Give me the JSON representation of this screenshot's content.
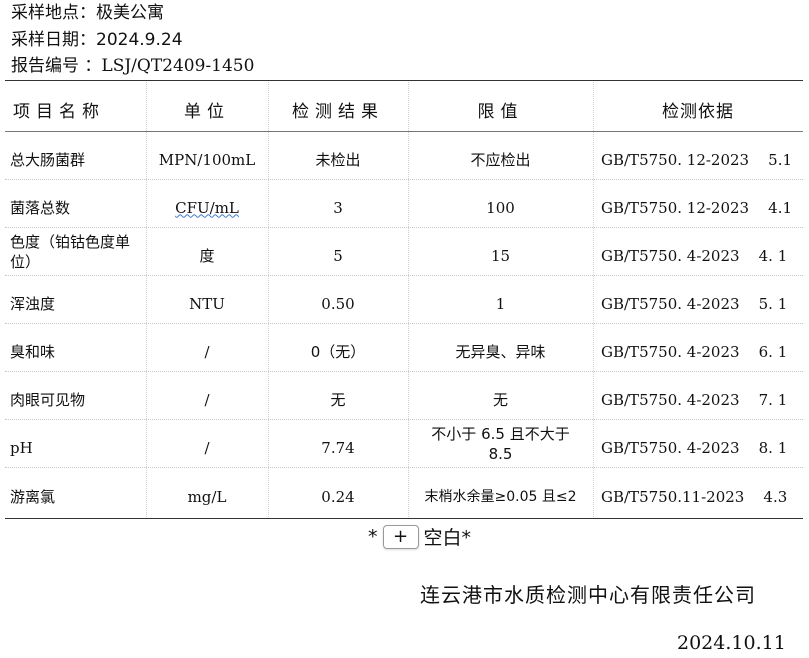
{
  "header": {
    "location": "采样地点：极美公寓",
    "date": "采样日期：2024.9.24",
    "report_no": "报告编号 ：LSJ/QT2409-1450"
  },
  "table": {
    "columns": [
      "项目名称",
      "单位",
      "检测结果",
      "限值",
      "检测依据"
    ],
    "rows": [
      {
        "item": "总大肠菌群",
        "unit": "MPN/100mL",
        "result": "未检出",
        "limit": "不应检出",
        "method": "GB/T5750. 12-2023    5.1"
      },
      {
        "item": "菌落总数",
        "unit": "CFU/mL",
        "result": "3",
        "limit": "100",
        "method": "GB/T5750. 12-2023    4.1"
      },
      {
        "item": "色度（铂钴色度单位）",
        "unit": "度",
        "result": "5",
        "limit": "15",
        "method": "GB/T5750. 4-2023    4. 1"
      },
      {
        "item": "浑浊度",
        "unit": "NTU",
        "result": "0.50",
        "limit": "1",
        "method": "GB/T5750. 4-2023    5. 1"
      },
      {
        "item": "臭和味",
        "unit": "/",
        "result": "0（无）",
        "limit": "无异臭、异味",
        "method": "GB/T5750. 4-2023    6. 1"
      },
      {
        "item": "肉眼可见物",
        "unit": "/",
        "result": "无",
        "limit": "无",
        "method": "GB/T5750. 4-2023    7. 1"
      },
      {
        "item": "pH",
        "unit": "/",
        "result": "7.74",
        "limit": "不小于 6.5 且不大于 8.5",
        "method": "GB/T5750. 4-2023    8. 1"
      },
      {
        "item": "游离氯",
        "unit": "mg/L",
        "result": "0.24",
        "limit": "末梢水余量≥0.05 且≤2",
        "method": "GB/T5750.11-2023    4.3"
      }
    ]
  },
  "blank": {
    "prefix": "*",
    "plus": "+",
    "text": "空白*"
  },
  "footer": {
    "company": "连云港市水质检测中心有限责任公司",
    "issue_date": "2024.10.11"
  }
}
